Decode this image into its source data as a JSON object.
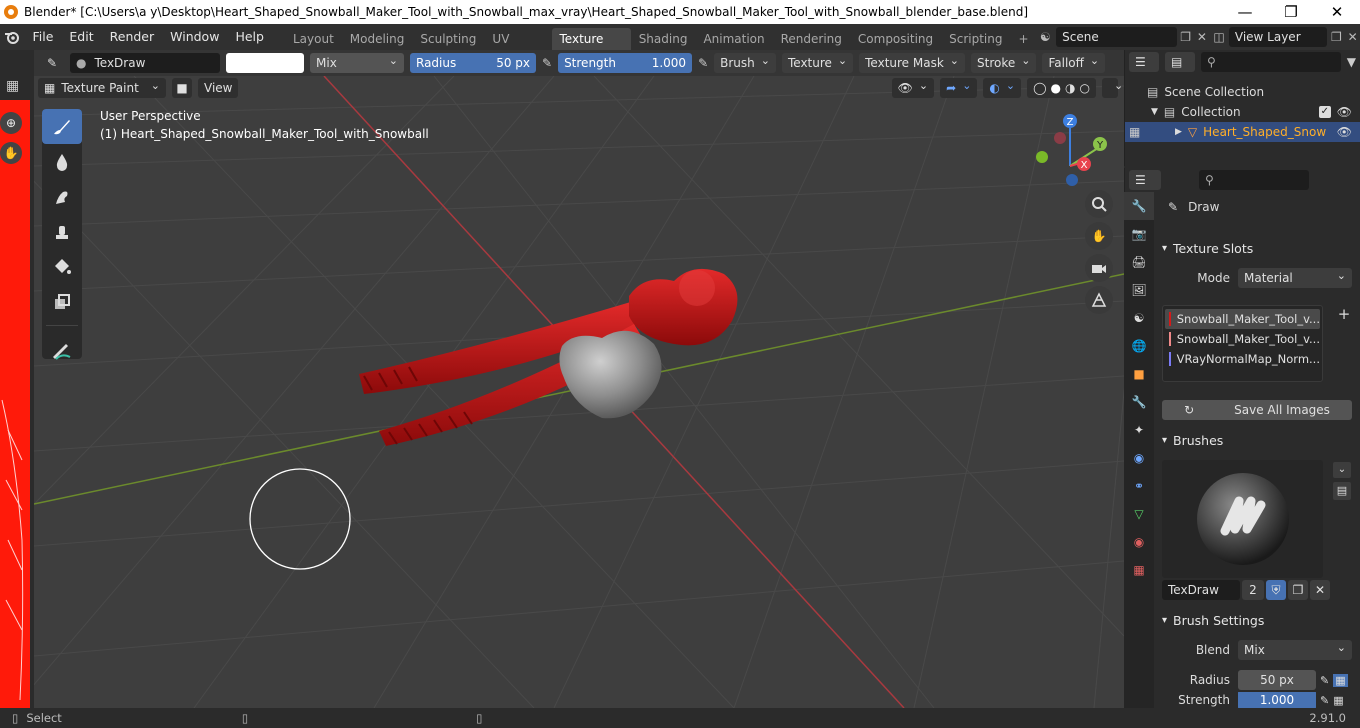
{
  "titlebar": {
    "title": "Blender* [C:\\Users\\a y\\Desktop\\Heart_Shaped_Snowball_Maker_Tool_with_Snowball_max_vray\\Heart_Shaped_Snowball_Maker_Tool_with_Snowball_blender_base.blend]",
    "minimize": "—",
    "maximize": "❐",
    "close": "✕"
  },
  "menubar": {
    "menus": [
      "File",
      "Edit",
      "Render",
      "Window",
      "Help"
    ],
    "workspaces": [
      "Layout",
      "Modeling",
      "Sculpting",
      "UV Editing",
      "Texture Paint",
      "Shading",
      "Animation",
      "Rendering",
      "Compositing",
      "Scripting"
    ],
    "active_workspace": "Texture Paint",
    "add_tab": "+",
    "scene": "Scene",
    "view_layer": "View Layer"
  },
  "tool_header": {
    "brush_name": "TexDraw",
    "blend": "Mix",
    "radius_label": "Radius",
    "radius_value": "50 px",
    "strength_label": "Strength",
    "strength_value": "1.000",
    "menus": [
      "Brush",
      "Texture",
      "Texture Mask",
      "Stroke",
      "Falloff"
    ]
  },
  "viewport_header": {
    "mode": "Texture Paint",
    "view": "View"
  },
  "viewport": {
    "perspective": "User Perspective",
    "object_info": "(1) Heart_Shaped_Snowball_Maker_Tool_with_Snowball",
    "gizmo_axes": [
      "X",
      "Y",
      "Z"
    ],
    "colors": {
      "x": "#e8434e",
      "y": "#8bc34a",
      "z": "#3d7fe0",
      "object": "#c81414",
      "snowball": "#8e8e8e"
    }
  },
  "outliner": {
    "scene_collection": "Scene Collection",
    "collection": "Collection",
    "object": "Heart_Shaped_Snow"
  },
  "properties": {
    "active_tool": "Draw",
    "texture_slots": {
      "title": "Texture Slots",
      "mode_label": "Mode",
      "mode_value": "Material",
      "slots": [
        {
          "name": "Snowball_Maker_Tool_v...",
          "color": "#d41a1a"
        },
        {
          "name": "Snowball_Maker_Tool_v...",
          "color": "#f08a8a"
        },
        {
          "name": "VRayNormalMap_Norm...",
          "color": "#7b7bf5"
        }
      ],
      "save_all": "Save All Images",
      "add": "+"
    },
    "brushes": {
      "title": "Brushes",
      "brush_name": "TexDraw",
      "users": "2"
    },
    "brush_settings": {
      "title": "Brush Settings",
      "blend_label": "Blend",
      "blend_value": "Mix",
      "radius_label": "Radius",
      "radius_value": "50 px",
      "strength_label": "Strength",
      "strength_value": "1.000"
    }
  },
  "statusbar": {
    "select": "Select",
    "version": "2.91.0"
  }
}
